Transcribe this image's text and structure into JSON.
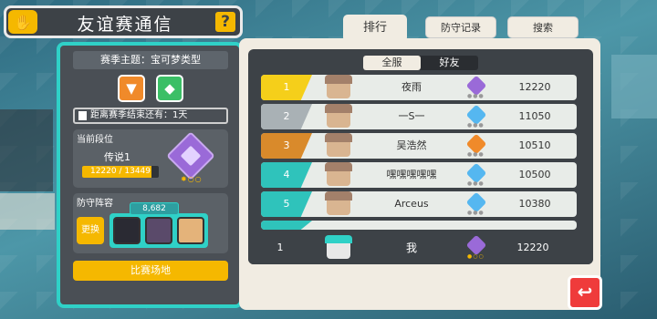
{
  "header": {
    "title": "友谊赛通信",
    "help_label": "?"
  },
  "left_panel": {
    "season_theme": "赛季主题：宝可梦类型",
    "countdown": "距离赛季结束还有：1天",
    "rank_section_label": "当前段位",
    "rank_name": "传说1",
    "rank_progress": "12220 / 13449",
    "rank_progress_fraction": 0.909,
    "defense_label": "防守阵容",
    "change_button": "更换",
    "team_power": "8,682",
    "arena_button": "比赛场地"
  },
  "tabs": {
    "ranking": "排行",
    "defense_record": "防守记录",
    "search": "搜索"
  },
  "filters": {
    "all_server": "全服",
    "friends": "好友"
  },
  "leaderboard": [
    {
      "rank": "1",
      "name": "夜雨",
      "score": "12220",
      "rank_color": "#f5cf1a",
      "badge_color": "#9a6ad8"
    },
    {
      "rank": "2",
      "name": "一S一",
      "score": "11050",
      "rank_color": "#a9b1b5",
      "badge_color": "#55b7f0"
    },
    {
      "rank": "3",
      "name": "吴浩然",
      "score": "10510",
      "rank_color": "#d98a2b",
      "badge_color": "#f08a2a"
    },
    {
      "rank": "4",
      "name": "嘿嘿嘿嘿嘿",
      "score": "10500",
      "rank_color": "#2fc3bb",
      "badge_color": "#55b7f0"
    },
    {
      "rank": "5",
      "name": "Arceus",
      "score": "10380",
      "rank_color": "#2fc3bb",
      "badge_color": "#55b7f0"
    }
  ],
  "me": {
    "rank": "1",
    "name": "我",
    "score": "12220"
  }
}
